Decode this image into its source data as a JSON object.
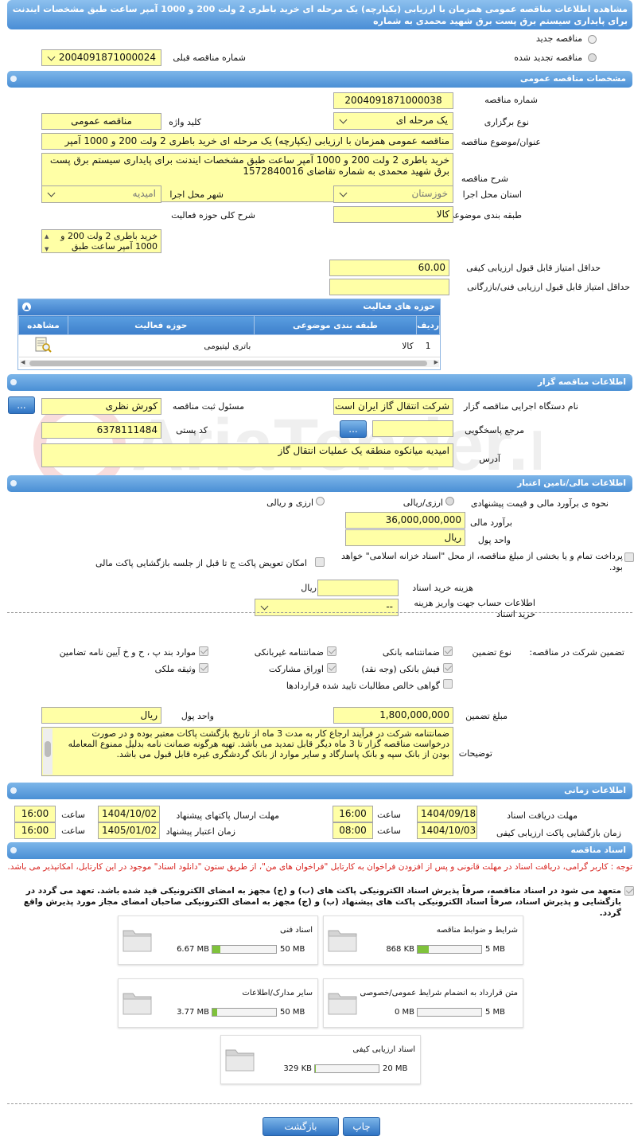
{
  "header": {
    "title": "مشاهده اطلاعات مناقصه عمومی همزمان با ارزیابی (یکپارچه) یک مرحله ای خرید باطری 2 ولت 200 و 1000 آمپر ساعت طبق مشخصات ایندنت برای پایداری سیستم برق پست برق شهید محمدی به شماره"
  },
  "tender_type": {
    "new_label": "مناقصه جدید",
    "renewed_label": "مناقصه تجدید شده",
    "previous_number_label": "شماره مناقصه قبلی",
    "previous_number": "2004091871000024"
  },
  "general": {
    "section_title": "مشخصات مناقصه عمومی",
    "number_label": "شماره مناقصه",
    "number": "2004091871000038",
    "holding_type_label": "نوع برگزاری",
    "holding_type": "یک مرحله ای",
    "keyword_label": "کلید واژه",
    "keyword": "مناقصه عمومی",
    "subject_label": "عنوان/موضوع مناقصه",
    "subject": "مناقصه عمومی همزمان با ارزیابی (یکپارچه) یک مرحله ای خرید باطری 2 ولت 200 و 1000 آمپر",
    "description_label": "شرح مناقصه",
    "description": "خرید باطری 2 ولت 200 و 1000 آمپر ساعت طبق مشخصات ایندنت برای پایداری سیستم برق پست برق شهید محمدی به شماره تقاضای 1572840016",
    "province_label": "استان محل اجرا",
    "province": "خوزستان",
    "city_label": "شهر محل اجرا",
    "city": "امیدیه",
    "category_label": "طبقه بندی موضوعی",
    "category": "کالا",
    "activity_scope_label": "شرح کلی حوزه فعالیت",
    "activity_scope": "خرید باطری 2 ولت 200 و 1000 آمپر ساعت طبق",
    "min_quality_label": "حداقل امتیاز قابل قبول ارزیابی کیفی",
    "min_quality": "60.00",
    "min_tech_label": "حداقل امتیاز قابل قبول ارزیابی فنی/بازرگانی",
    "min_tech": ""
  },
  "activity_table": {
    "title": "حوزه های فعالیت",
    "columns": [
      "ردیف",
      "طبقه بندی موضوعی",
      "حوزه فعالیت",
      "مشاهده"
    ],
    "rows": [
      {
        "row": "1",
        "category": "کالا",
        "scope": "باتری لیتیومی"
      }
    ]
  },
  "organizer": {
    "section_title": "اطلاعات مناقصه گزار",
    "org_label": "نام دستگاه اجرایی مناقصه گزار",
    "org": "شرکت انتقال گاز ایران  است",
    "registrar_label": "مسئول ثبت مناقصه",
    "registrar": "کورش نظری",
    "reference_label": "مرجع پاسخگویی",
    "reference": "",
    "postal_label": "کد پستی",
    "postal": "6378111484",
    "address_label": "آدرس",
    "address": "امیدیه میانکوه منطقه یک عملیات انتقال گاز",
    "more_button": "..."
  },
  "financial": {
    "section_title": "اطلاعات مالی/تامین اعتبار",
    "estimate_method_label": "نحوه ی برآورد مالی و قیمت پیشنهادی",
    "option_currency_rial": "ارزی/ریالی",
    "option_currency_and_rial": "ارزی و ریالی",
    "estimate_label": "برآورد مالی",
    "estimate": "36,000,000,000",
    "currency_label": "واحد پول",
    "currency": "ریال",
    "treasury_label": "پرداخت تمام و یا بخشی از مبلغ مناقصه، از محل \"اسناد خزانه اسلامی\" خواهد بود.",
    "envelope_swap_label": "امکان تعویض پاکت ج تا قبل از جلسه بازگشایی پاکت مالی",
    "doc_cost_label": "هزینه خرید اسناد",
    "doc_cost": "",
    "doc_cost_unit": "ریال",
    "account_label": "اطلاعات حساب جهت واریز هزینه خرید اسناد",
    "account": "--"
  },
  "guarantee": {
    "label": "تضمین شرکت در مناقصه:",
    "type_label": "نوع تضمین",
    "options": {
      "bank_guarantee": "ضمانتنامه بانکی",
      "non_bank_guarantee": "ضمانتنامه غیربانکی",
      "bylaw_items": "موارد بند پ ، ح و خ آیین نامه تضامین",
      "bank_receipt": "فیش بانکی (وجه نقد)",
      "participation_bonds": "اوراق مشارکت",
      "property_collateral": "وثیقه ملکی",
      "net_claims_certificate": "گواهی خالص مطالبات تایید شده قراردادها"
    },
    "amount_label": "مبلغ تضمین",
    "amount": "1,800,000,000",
    "currency_label": "واحد پول",
    "currency": "ریال",
    "notes_label": "توضیحات",
    "notes": "ضمانتنامه شرکت در فرآیند ارجاع کار به مدت 3 ماه از تاریخ بازگشت پاکات معتبر بوده و در صورت درخواست مناقصه گزار تا 3 ماه دیگر قابل تمدید می باشد. تهیه هرگونه ضمانت نامه بدلیل ممنوع المعامله بودن از بانک سپه و بانک پاسارگاد و سایر موارد از بانک گردشگری غیره قابل قبول می باشد."
  },
  "timing": {
    "section_title": "اطلاعات زمانی",
    "doc_receive_label": "مهلت دریافت اسناد",
    "doc_receive_date": "1404/09/18",
    "doc_receive_time": "16:00",
    "submit_deadline_label": "مهلت ارسال پاکتهای پیشنهاد",
    "submit_deadline_date": "1404/10/02",
    "submit_deadline_time": "16:00",
    "quality_open_label": "زمان بازگشایی پاکت ارزیابی کیفی",
    "quality_open_date": "1404/10/03",
    "quality_open_time": "08:00",
    "validity_label": "زمان اعتبار پیشنهاد",
    "validity_date": "1405/01/02",
    "validity_time": "16:00",
    "time_label": "ساعت"
  },
  "documents": {
    "section_title": "اسناد مناقصه",
    "notice": "توجه : کاربر گرامی، دریافت اسناد در مهلت قانونی و پس از افزودن فراخوان به کارتابل \"فراخوان های من\"، از طریق ستون \"دانلود اسناد\" موجود در این کارتابل، امکانپذیر می باشد.",
    "commitment": "متعهد می شود در اسناد مناقصه، صرفاً پذیرش اسناد الکترونیکی پاکت های (ب) و (ج) مجهز به امضای الکترونیکی قید شده باشد. تعهد می گردد در بازگشایی و پذیرش اسناد، صرفاً اسناد الکترونیکی پاکت های پیشنهاد (ب) و (ج) مجهز به امضای الکترونیکی صاحبان امضای مجاز مورد پذیرش واقع گردد.",
    "files": [
      {
        "title": "شرایط و ضوابط مناقصه",
        "size": "868 KB",
        "max": "5 MB",
        "fraction": 0.17
      },
      {
        "title": "اسناد فنی",
        "size": "6.67 MB",
        "max": "50 MB",
        "fraction": 0.13
      },
      {
        "title": "متن قرارداد به انضمام شرایط عمومی/خصوصی",
        "size": "0 MB",
        "max": "5 MB",
        "fraction": 0.0
      },
      {
        "title": "سایر مدارک/اطلاعات",
        "size": "3.77 MB",
        "max": "50 MB",
        "fraction": 0.075
      },
      {
        "title": "اسناد ارزیابی کیفی",
        "size": "329 KB",
        "max": "20 MB",
        "fraction": 0.016
      }
    ]
  },
  "footer": {
    "print_button": "چاپ",
    "back_button": "بازگشت"
  },
  "watermark": "AriaTender.neT"
}
